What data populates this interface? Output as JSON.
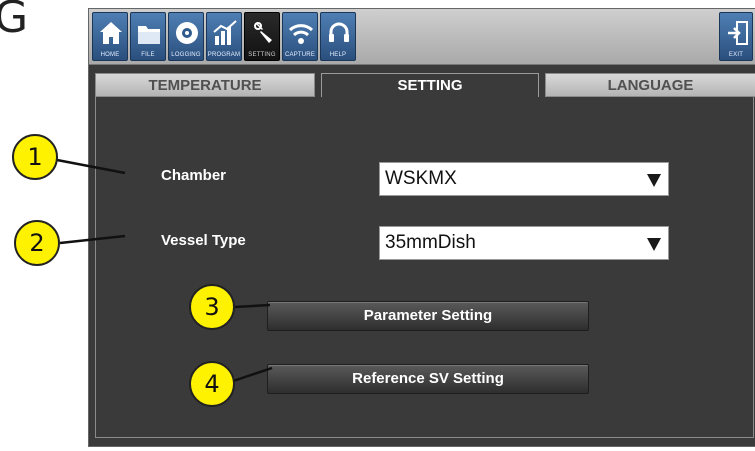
{
  "heading_fragment": "G",
  "toolbar": {
    "buttons": [
      {
        "label": "HOME",
        "icon": "home-icon"
      },
      {
        "label": "FILE",
        "icon": "folder-icon"
      },
      {
        "label": "LOGGING",
        "icon": "disc-icon"
      },
      {
        "label": "PROGRAM",
        "icon": "chart-icon"
      },
      {
        "label": "SETTING",
        "icon": "wrench-icon",
        "active": true
      },
      {
        "label": "CAPTURE",
        "icon": "wifi-icon"
      },
      {
        "label": "HELP",
        "icon": "headset-icon"
      }
    ],
    "exit_label": "EXIT",
    "exit_icon": "exit-icon"
  },
  "tabs": [
    {
      "label": "TEMPERATURE",
      "active": false
    },
    {
      "label": "SETTING",
      "active": true
    },
    {
      "label": "LANGUAGE",
      "active": false
    }
  ],
  "form": {
    "chamber_label": "Chamber",
    "chamber_value": "WSKMX",
    "vessel_label": "Vessel Type",
    "vessel_value": "35mmDish"
  },
  "buttons": {
    "parameter_setting": "Parameter Setting",
    "reference_sv_setting": "Reference SV Setting"
  },
  "callouts": [
    "1",
    "2",
    "3",
    "4"
  ],
  "colors": {
    "toolbar_button": "#2f5a8c",
    "panel_bg": "#3a3a3a",
    "callout_fill": "#fff200"
  }
}
